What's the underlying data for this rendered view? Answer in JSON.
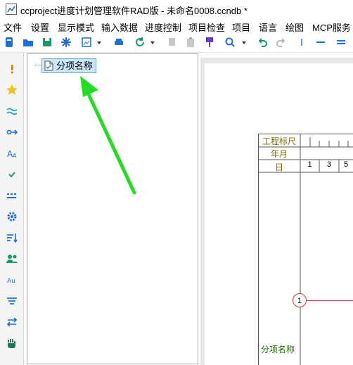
{
  "window": {
    "title": "ccproject进度计划管理软件RAD版 - 未命名0008.ccndb *"
  },
  "menu": [
    "文件",
    "设置",
    "显示模式",
    "输入数据",
    "进度控制",
    "项目检查",
    "项目",
    "语言",
    "绘图",
    "MCP服务"
  ],
  "tree": {
    "root_label": "分项名称"
  },
  "gantt": {
    "header_rows": [
      "工程标尺",
      "年月",
      "日"
    ],
    "days": [
      "1",
      "3",
      "5"
    ],
    "milestone_number": "1",
    "row_label": "分项名称"
  },
  "colors": {
    "header_text": "#7a6a00",
    "milestone": "#e03030",
    "arrow": "#22dd22",
    "selection": "#cce8ff"
  }
}
